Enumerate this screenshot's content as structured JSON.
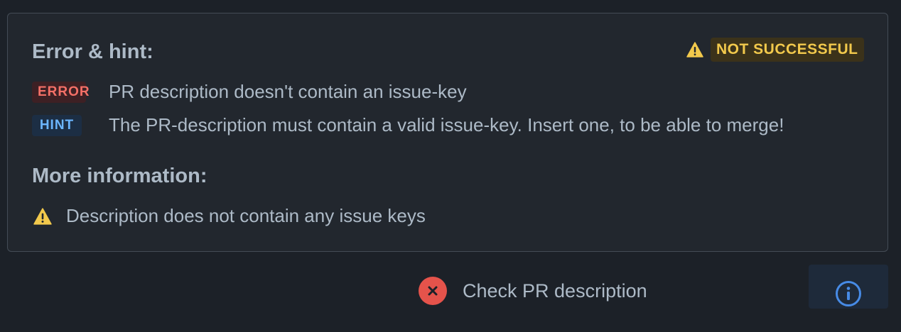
{
  "card": {
    "error_hint_title": "Error & hint:",
    "status": {
      "label": "NOT SUCCESSFUL",
      "icon": "warning-icon",
      "color": "#f2c94c"
    },
    "error": {
      "tag": "ERROR",
      "message": "PR description doesn't contain an issue-key",
      "color": "#f47067"
    },
    "hint": {
      "tag": "HINT",
      "message": "The PR-description must contain a valid issue-key. Insert one, to be able to merge!",
      "color": "#6cb6ff"
    },
    "more_info_title": "More information:",
    "more_info": {
      "icon": "warning-icon",
      "text": "Description does not contain any issue keys"
    }
  },
  "check": {
    "status_icon": "x-circle-icon",
    "label": "Check PR description",
    "status_color": "#e5534b"
  },
  "info_button": {
    "icon": "info-icon",
    "color": "#478be6"
  }
}
